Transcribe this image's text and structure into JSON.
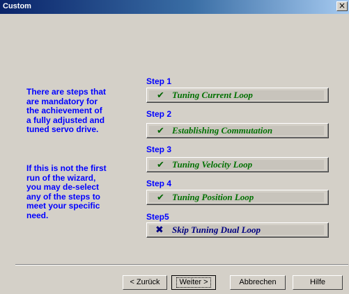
{
  "window": {
    "title": "Custom",
    "close_glyph": "×"
  },
  "left_panel": {
    "paragraph1": [
      "There are steps that",
      "are mandatory for",
      "the achievement of",
      "a fully adjusted and",
      "tuned servo drive."
    ],
    "paragraph2": [
      "If this is not the first",
      "run of the wizard,",
      "you may de-select",
      "any of the  steps to",
      "meet your specific",
      "need."
    ]
  },
  "steps": [
    {
      "label": "Step 1",
      "text": "Tuning Current Loop",
      "icon": "check-icon",
      "glyph": "✔"
    },
    {
      "label": "Step 2",
      "text": "Establishing Commutation",
      "icon": "check-icon",
      "glyph": "✔"
    },
    {
      "label": "Step 3",
      "text": "Tuning Velocity Loop",
      "icon": "check-icon",
      "glyph": "✔"
    },
    {
      "label": "Step 4",
      "text": "Tuning Position Loop",
      "icon": "check-icon",
      "glyph": "✔"
    },
    {
      "label": "Step5",
      "text": "Skip Tuning Dual Loop",
      "icon": "x-icon",
      "glyph": "✖"
    }
  ],
  "buttons": {
    "back": "< Zurück",
    "next": "Weiter >",
    "cancel": "Abbrechen",
    "help": "Hilfe"
  }
}
